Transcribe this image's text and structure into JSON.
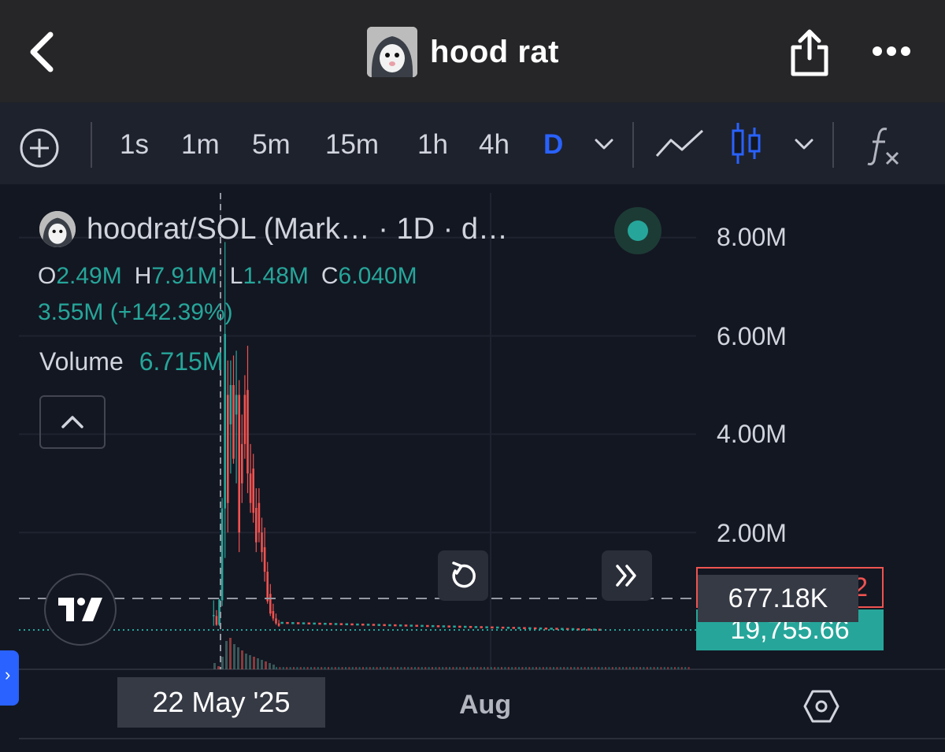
{
  "header": {
    "title": "hood rat",
    "icons": [
      "back-arrow-icon",
      "share-icon",
      "more-icon"
    ]
  },
  "toolbar": {
    "intervals": [
      {
        "label": "1s",
        "active": false
      },
      {
        "label": "1m",
        "active": false
      },
      {
        "label": "5m",
        "active": false
      },
      {
        "label": "15m",
        "active": false
      },
      {
        "label": "1h",
        "active": false
      },
      {
        "label": "4h",
        "active": false
      },
      {
        "label": "D",
        "active": true
      }
    ],
    "icons": [
      "add-circle-icon",
      "chevron-down-icon",
      "line-chart-icon",
      "candlestick-icon",
      "indicators-fx-icon"
    ]
  },
  "legend": {
    "symbol": "hoodrat/SOL (Mark… · 1D · d…",
    "ohlc": {
      "o_key": "O",
      "o": "2.49M",
      "h_key": "H",
      "h": "7.91M",
      "l_key": "L",
      "l": "1.48M",
      "c_key": "C",
      "c": "6.040M"
    },
    "change": "3.55M (+142.39%)",
    "volume_label": "Volume",
    "volume_value": "6.715M"
  },
  "price_scale": {
    "labels": [
      "8.00M",
      "6.00M",
      "4.00M",
      "2.00M"
    ],
    "crosshair_price": "677.18K",
    "red_tag": "2",
    "last_price": "19,755.66"
  },
  "time_scale": {
    "crosshair_date": "22 May '25",
    "month_label": "Aug"
  },
  "colors": {
    "up": "#26a69a",
    "down": "#ef5350",
    "accent": "#2962ff",
    "background": "#131722"
  },
  "chart_data": {
    "type": "candlestick",
    "symbol": "hoodrat/SOL",
    "interval": "1D",
    "ylim": [
      0,
      8800000
    ],
    "y_ticks": [
      2000000,
      4000000,
      6000000,
      8000000
    ],
    "x_labels": [
      "22 May '25",
      "Aug"
    ],
    "highlighted_candle": {
      "date": "22 May '25",
      "open": 2490000,
      "high": 7910000,
      "low": 1480000,
      "close": 6040000,
      "volume": 6715000
    },
    "candles": [
      [
        0.32,
        0.62,
        0.1,
        0.3,
        1
      ],
      [
        0.3,
        0.42,
        0.1,
        0.12,
        0
      ],
      [
        0.12,
        0.65,
        0.1,
        0.63,
        1
      ],
      [
        0.62,
        2.7,
        0.5,
        2.49,
        1
      ],
      [
        2.49,
        7.91,
        1.48,
        6.04,
        1
      ],
      [
        4.8,
        5.5,
        2.0,
        2.6,
        0
      ],
      [
        4.2,
        5.5,
        3.2,
        5.0,
        1
      ],
      [
        5.0,
        5.6,
        3.4,
        3.5,
        0
      ],
      [
        4.4,
        5.7,
        3.0,
        4.8,
        1
      ],
      [
        4.8,
        5.1,
        1.6,
        2.0,
        0
      ],
      [
        3.8,
        4.4,
        2.6,
        3.0,
        0
      ],
      [
        4.8,
        5.2,
        3.5,
        3.8,
        0
      ],
      [
        4.9,
        5.8,
        2.8,
        3.2,
        0
      ],
      [
        3.2,
        3.8,
        2.4,
        2.6,
        0
      ],
      [
        3.3,
        3.6,
        2.2,
        2.4,
        0
      ],
      [
        2.5,
        2.9,
        1.6,
        1.8,
        0
      ],
      [
        2.6,
        2.9,
        1.8,
        2.0,
        0
      ],
      [
        2.0,
        2.3,
        1.4,
        1.6,
        0
      ],
      [
        1.7,
        2.1,
        1.0,
        1.2,
        0
      ],
      [
        1.2,
        1.4,
        0.55,
        0.6,
        0
      ],
      [
        0.75,
        0.95,
        0.3,
        0.35,
        0
      ],
      [
        0.4,
        0.55,
        0.2,
        0.25,
        0
      ],
      [
        0.25,
        0.35,
        0.12,
        0.15,
        0
      ],
      [
        0.15,
        0.22,
        0.08,
        0.1,
        0
      ]
    ],
    "tail": {
      "start": 0.16,
      "end": 0.02,
      "count": 60
    },
    "candle_units": "millions",
    "volume_bars_relative": [
      0.2,
      0.1,
      0.4,
      0.9,
      1.0,
      0.8,
      0.7,
      0.6,
      0.5,
      0.45,
      0.4,
      0.35,
      0.3,
      0.25,
      0.2,
      0.15
    ]
  }
}
